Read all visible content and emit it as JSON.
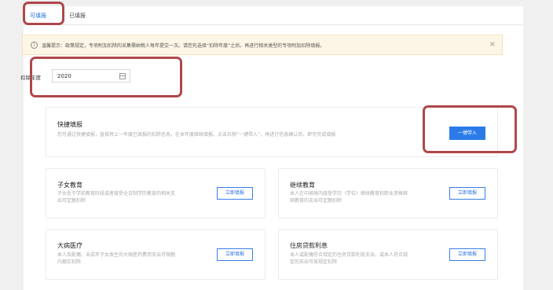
{
  "tabs": [
    {
      "label": "可填报",
      "active": true
    },
    {
      "label": "已填报",
      "active": false
    }
  ],
  "notice": {
    "text": "温馨提示：政策规定，专项附加扣除的采集需纳税人每年提交一次。请您先选择“扣除年度”之后，再进行相关类型的专项附加扣除填报。",
    "close": "×"
  },
  "year": {
    "label": "扣除年度",
    "value": "2020"
  },
  "quick": {
    "title": "快捷填报",
    "desc": "您可通过快捷填报，直接将上一年度已填报的扣除信息，在本年度继续填报。点击右侧“一键带入”，再进行信息确认后，即可完成填报",
    "button": "一键带入"
  },
  "cards": [
    {
      "title": "子女教育",
      "desc1": "子女处于学前教育阶段或者接受全日制学历教育的相关支",
      "desc2": "出可定额扣除",
      "button": "立即填报"
    },
    {
      "title": "继续教育",
      "desc1": "本人在中国境内接受学历（学位）继续教育和职业资格继",
      "desc2": "续教育的支出可定额扣除",
      "button": "立即填报"
    },
    {
      "title": "大病医疗",
      "desc1": "本人及配偶、未成年子女发生的大病医药费用支出可限额",
      "desc2": "内据实扣除",
      "button": "立即填报"
    },
    {
      "title": "住房贷款利息",
      "desc1": "本人或配偶符合规定的住房贷款利息支出，或本人符合规",
      "desc2": "定的支出可按规定扣除",
      "button": "立即填报"
    }
  ],
  "colors": {
    "accent": "#2a7be8",
    "highlight": "#b0474a",
    "notice_bg": "#fdf6e6"
  }
}
